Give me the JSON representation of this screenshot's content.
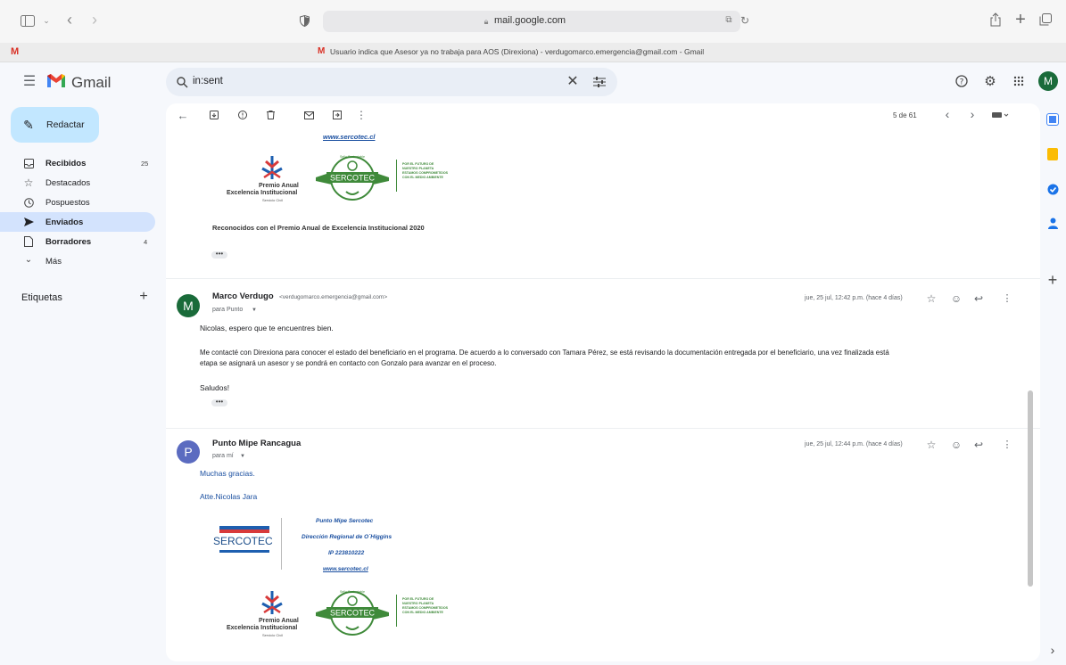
{
  "browser": {
    "url": "mail.google.com",
    "tab_title": "Usuario indica que Asesor ya no trabaja para AOS (Direxiona) - verdugomarco.emergencia@gmail.com - Gmail",
    "gmail_favicon_letter": "M",
    "plus": "+"
  },
  "header": {
    "app_name": "Gmail",
    "search_query": "in:sent",
    "account_initial": "M"
  },
  "sidebar": {
    "compose_label": "Redactar",
    "items": [
      {
        "label": "Recibidos",
        "count": "25",
        "bold": true
      },
      {
        "label": "Destacados",
        "count": ""
      },
      {
        "label": "Pospuestos",
        "count": ""
      },
      {
        "label": "Enviados",
        "count": "",
        "active": true
      },
      {
        "label": "Borradores",
        "count": "4",
        "bold": true
      },
      {
        "label": "Más",
        "count": ""
      }
    ],
    "labels_heading": "Etiquetas",
    "labels_add": "+"
  },
  "toolbar": {
    "pagination": "5 de 61"
  },
  "thread": {
    "quoted_link": "www.sercotec.cl",
    "award_caption": "Reconocidos con el Premio Anual de Excelencia Institucional 2020",
    "messages": [
      {
        "avatar": "M",
        "sender": "Marco Verdugo",
        "email": "<verdugomarco.emergencia@gmail.com>",
        "to": "para Punto",
        "date": "jue, 25 jul, 12:42 p.m. (hace 4 días)",
        "greeting": "Nicolas, espero que te encuentres bien.",
        "p1": "Me contacté con Direxiona para conocer el estado del beneficiario en el programa. De acuerdo a lo conversado con Tamara Pérez, se está revisando la documentación entregada por el beneficiario, una vez finalizada está",
        "p1b": "etapa se asignará un asesor y se pondrá en contacto con Gonzalo para avanzar en el proceso.",
        "closing": "Saludos!"
      },
      {
        "avatar": "P",
        "sender": "Punto Mipe Rancagua",
        "to": "para mí",
        "date": "jue, 25 jul, 12:44 p.m. (hace 4 días)",
        "line1": "Muchas gracias.",
        "line2": "Atte.Nicolas Jara"
      }
    ],
    "signature": {
      "logo": "SERCOTEC",
      "l1": "Punto Mipe Sercotec",
      "l2": "Dirección Regional de O´Higgins",
      "l3": "IP 223810222",
      "l4": "www.sercotec.cl"
    },
    "award": {
      "t1": "Premio Anual",
      "t2": "Excelencia Institucional",
      "t3": "Servicio Civil",
      "badge": "SERCOTEC",
      "badge_top": "Sello Sustentable",
      "slogan1": "POR EL FUTURO DE",
      "slogan2": "NUESTRO PLANETA",
      "slogan3": "ESTAMOS COMPROMETIDOS",
      "slogan4": "CON EL MEDIO AMBIENTE"
    },
    "more_dots": "•••"
  },
  "colors": {
    "accent": "#c2e7ff",
    "active_nav": "#d3e3fd",
    "avatar_m": "#1a6b3a",
    "avatar_p": "#5b6bc0",
    "sercotec_green": "#3f8a3a"
  }
}
